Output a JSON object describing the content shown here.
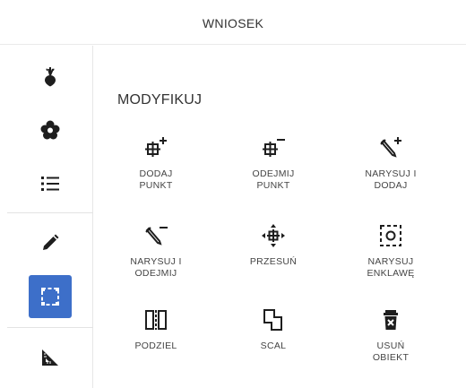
{
  "header": {
    "title": "WNIOSEK"
  },
  "sidebar": {
    "items": [
      {
        "icon": "beet-icon"
      },
      {
        "icon": "flower-icon"
      },
      {
        "icon": "list-icon"
      },
      {
        "icon": "pencil-icon"
      },
      {
        "icon": "select-area-icon",
        "active": true
      },
      {
        "icon": "measure-icon"
      }
    ],
    "active_color": "#3d6fc9"
  },
  "main": {
    "section_title": "MODYFIKUJ",
    "tools": [
      {
        "label": "DODAJ\nPUNKT",
        "icon": "add-point-icon"
      },
      {
        "label": "ODEJMIJ\nPUNKT",
        "icon": "remove-point-icon"
      },
      {
        "label": "NARYSUJ I\nDODAJ",
        "icon": "draw-add-icon"
      },
      {
        "label": "NARYSUJ I\nODEJMIJ",
        "icon": "draw-subtract-icon"
      },
      {
        "label": "PRZESUŃ",
        "icon": "move-icon"
      },
      {
        "label": "NARYSUJ\nENKLAWĘ",
        "icon": "enclave-icon"
      },
      {
        "label": "PODZIEL",
        "icon": "split-icon"
      },
      {
        "label": "SCAL",
        "icon": "merge-icon"
      },
      {
        "label": "USUŃ\nOBIEKT",
        "icon": "delete-icon"
      }
    ]
  }
}
